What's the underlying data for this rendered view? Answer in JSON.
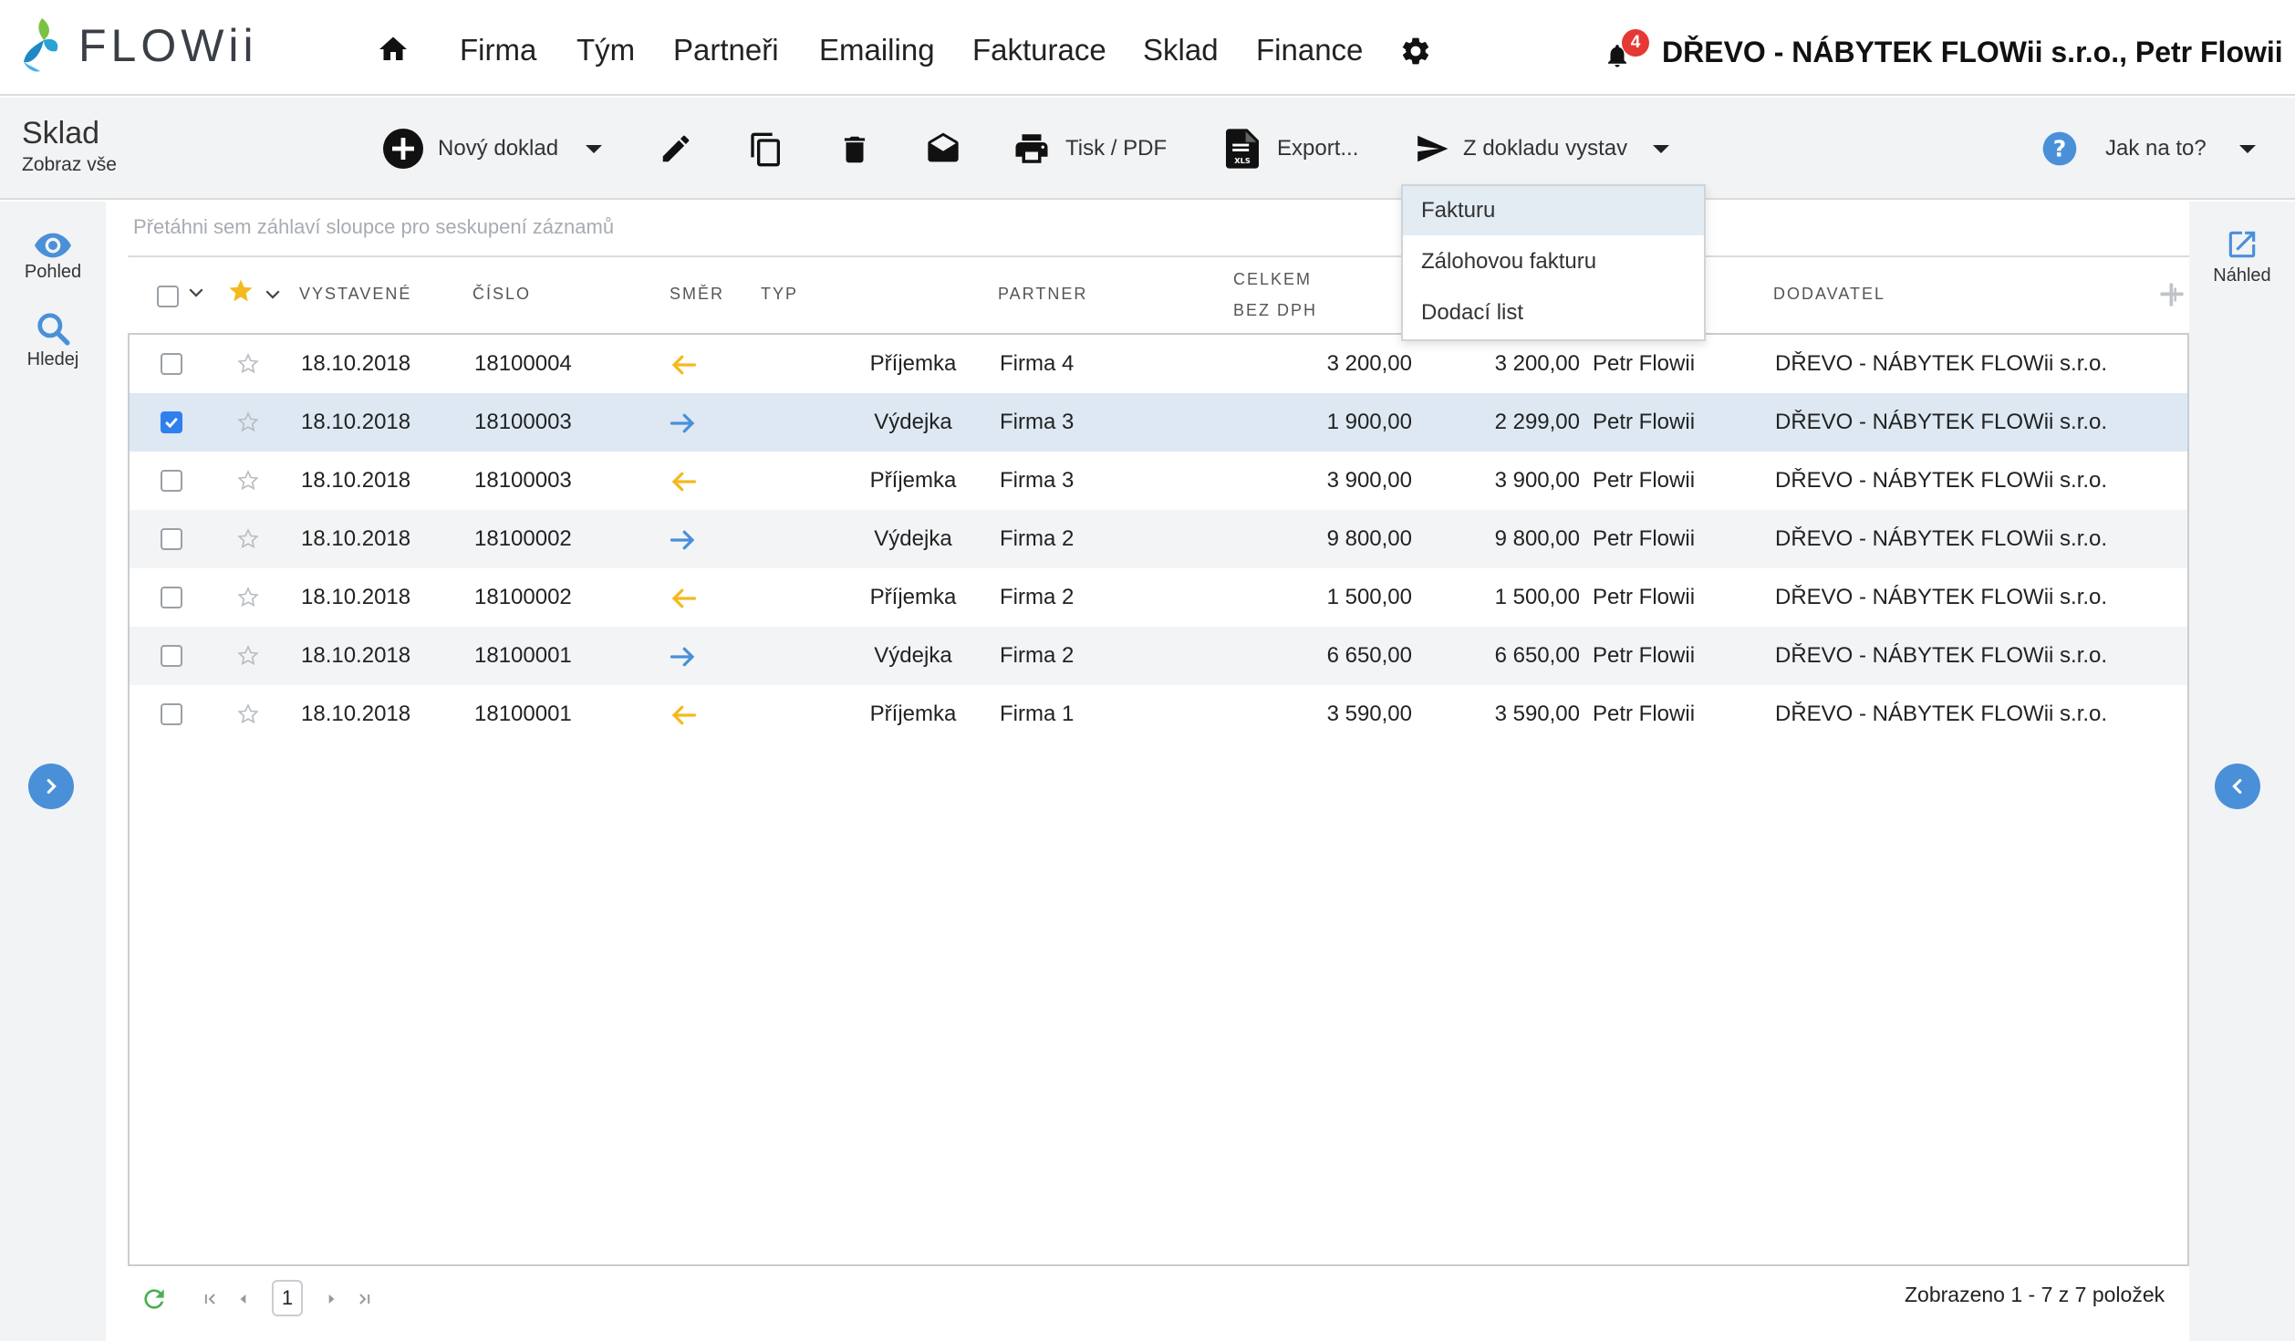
{
  "app": {
    "logo_text": "FLOWii",
    "company_user": "DŘEVO - NÁBYTEK FLOWii s.r.o., Petr Flowii",
    "notification_count": "4"
  },
  "nav": {
    "items": [
      "Firma",
      "Tým",
      "Partneři",
      "Emailing",
      "Fakturace",
      "Sklad",
      "Finance"
    ]
  },
  "module": {
    "title": "Sklad",
    "subtitle": "Zobraz vše"
  },
  "toolbar": {
    "new_doc": "Nový doklad",
    "print": "Tisk / PDF",
    "export": "Export...",
    "issue_from": "Z dokladu vystav",
    "help": "Jak na to?"
  },
  "dropdown": {
    "items": [
      "Fakturu",
      "Zálohovou fakturu",
      "Dodací list"
    ],
    "active_index": 0
  },
  "sidebar": {
    "view": "Pohled",
    "search": "Hledej",
    "preview": "Náhled"
  },
  "grid": {
    "group_hint": "Přetáhni sem záhlaví sloupce pro seskupení záznamů",
    "headers": {
      "issued": "VYSTAVENÉ",
      "number": "ČÍSLO",
      "direction": "SMĚR",
      "type": "TYP",
      "partner": "PARTNER",
      "total_line1": "CELKEM",
      "total_line2": "BEZ DPH",
      "supplier": "DODAVATEL"
    },
    "rows": [
      {
        "selected": false,
        "date": "18.10.2018",
        "number": "18100004",
        "direction": "in",
        "type": "Příjemka",
        "partner": "Firma 4",
        "total_net": "3 200,00",
        "total": "3 200,00",
        "person": "Petr Flowii",
        "supplier": "DŘEVO - NÁBYTEK FLOWii s.r.o."
      },
      {
        "selected": true,
        "date": "18.10.2018",
        "number": "18100003",
        "direction": "out",
        "type": "Výdejka",
        "partner": "Firma 3",
        "total_net": "1 900,00",
        "total": "2 299,00",
        "person": "Petr Flowii",
        "supplier": "DŘEVO - NÁBYTEK FLOWii s.r.o."
      },
      {
        "selected": false,
        "date": "18.10.2018",
        "number": "18100003",
        "direction": "in",
        "type": "Příjemka",
        "partner": "Firma 3",
        "total_net": "3 900,00",
        "total": "3 900,00",
        "person": "Petr Flowii",
        "supplier": "DŘEVO - NÁBYTEK FLOWii s.r.o."
      },
      {
        "selected": false,
        "date": "18.10.2018",
        "number": "18100002",
        "direction": "out",
        "type": "Výdejka",
        "partner": "Firma 2",
        "total_net": "9 800,00",
        "total": "9 800,00",
        "person": "Petr Flowii",
        "supplier": "DŘEVO - NÁBYTEK FLOWii s.r.o."
      },
      {
        "selected": false,
        "date": "18.10.2018",
        "number": "18100002",
        "direction": "in",
        "type": "Příjemka",
        "partner": "Firma 2",
        "total_net": "1 500,00",
        "total": "1 500,00",
        "person": "Petr Flowii",
        "supplier": "DŘEVO - NÁBYTEK FLOWii s.r.o."
      },
      {
        "selected": false,
        "date": "18.10.2018",
        "number": "18100001",
        "direction": "out",
        "type": "Výdejka",
        "partner": "Firma 2",
        "total_net": "6 650,00",
        "total": "6 650,00",
        "person": "Petr Flowii",
        "supplier": "DŘEVO - NÁBYTEK FLOWii s.r.o."
      },
      {
        "selected": false,
        "date": "18.10.2018",
        "number": "18100001",
        "direction": "in",
        "type": "Příjemka",
        "partner": "Firma 1",
        "total_net": "3 590,00",
        "total": "3 590,00",
        "person": "Petr Flowii",
        "supplier": "DŘEVO - NÁBYTEK FLOWii s.r.o."
      }
    ]
  },
  "pager": {
    "page": "1",
    "status": "Zobrazeno 1 - 7 z 7 položek"
  },
  "colors": {
    "accent": "#4a90d9",
    "checkbox": "#2f80ed",
    "arrow_in": "#f5b91e",
    "arrow_out": "#4a90d9",
    "badge": "#e53935",
    "star_header": "#f5b91e",
    "refresh": "#4caf50"
  }
}
